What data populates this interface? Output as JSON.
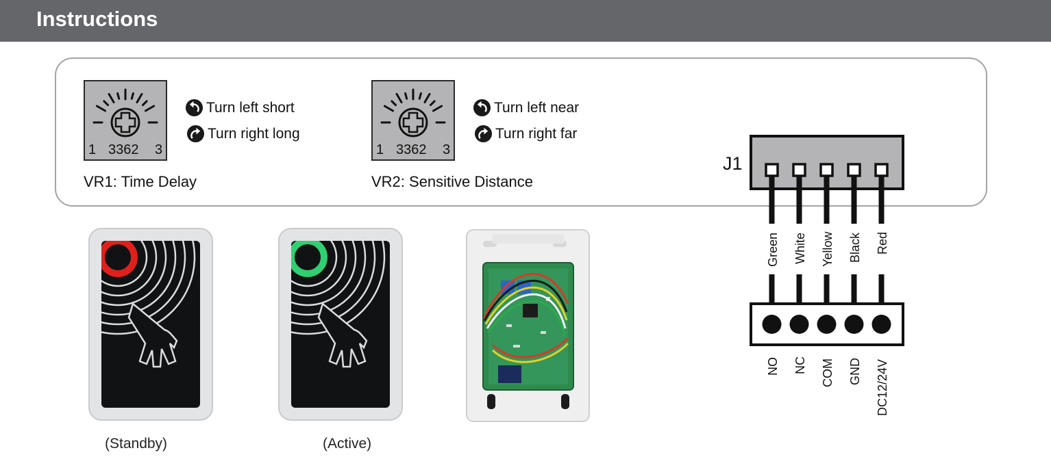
{
  "header": {
    "title": "Instructions"
  },
  "vr1": {
    "numbers": [
      "1",
      "3362",
      "3"
    ],
    "turn_left": "Turn left short",
    "turn_right": "Turn right long",
    "caption": "VR1: Time Delay"
  },
  "vr2": {
    "numbers": [
      "1",
      "3362",
      "3"
    ],
    "turn_left": "Turn left near",
    "turn_right": "Turn right far",
    "caption": "VR2: Sensitive Distance"
  },
  "connector": {
    "label": "J1",
    "wires": [
      "Green",
      "White",
      "Yellow",
      "Black",
      "Red"
    ],
    "terminals": [
      "NO",
      "NC",
      "COM",
      "GND",
      "DC12/24V"
    ]
  },
  "devices": {
    "standby_caption": "(Standby)",
    "active_caption": "(Active)"
  },
  "colors": {
    "header_bg": "#65666a",
    "standby_led": "#e0201b",
    "active_led": "#2fcf72",
    "pcb": "#2f8a4e"
  }
}
